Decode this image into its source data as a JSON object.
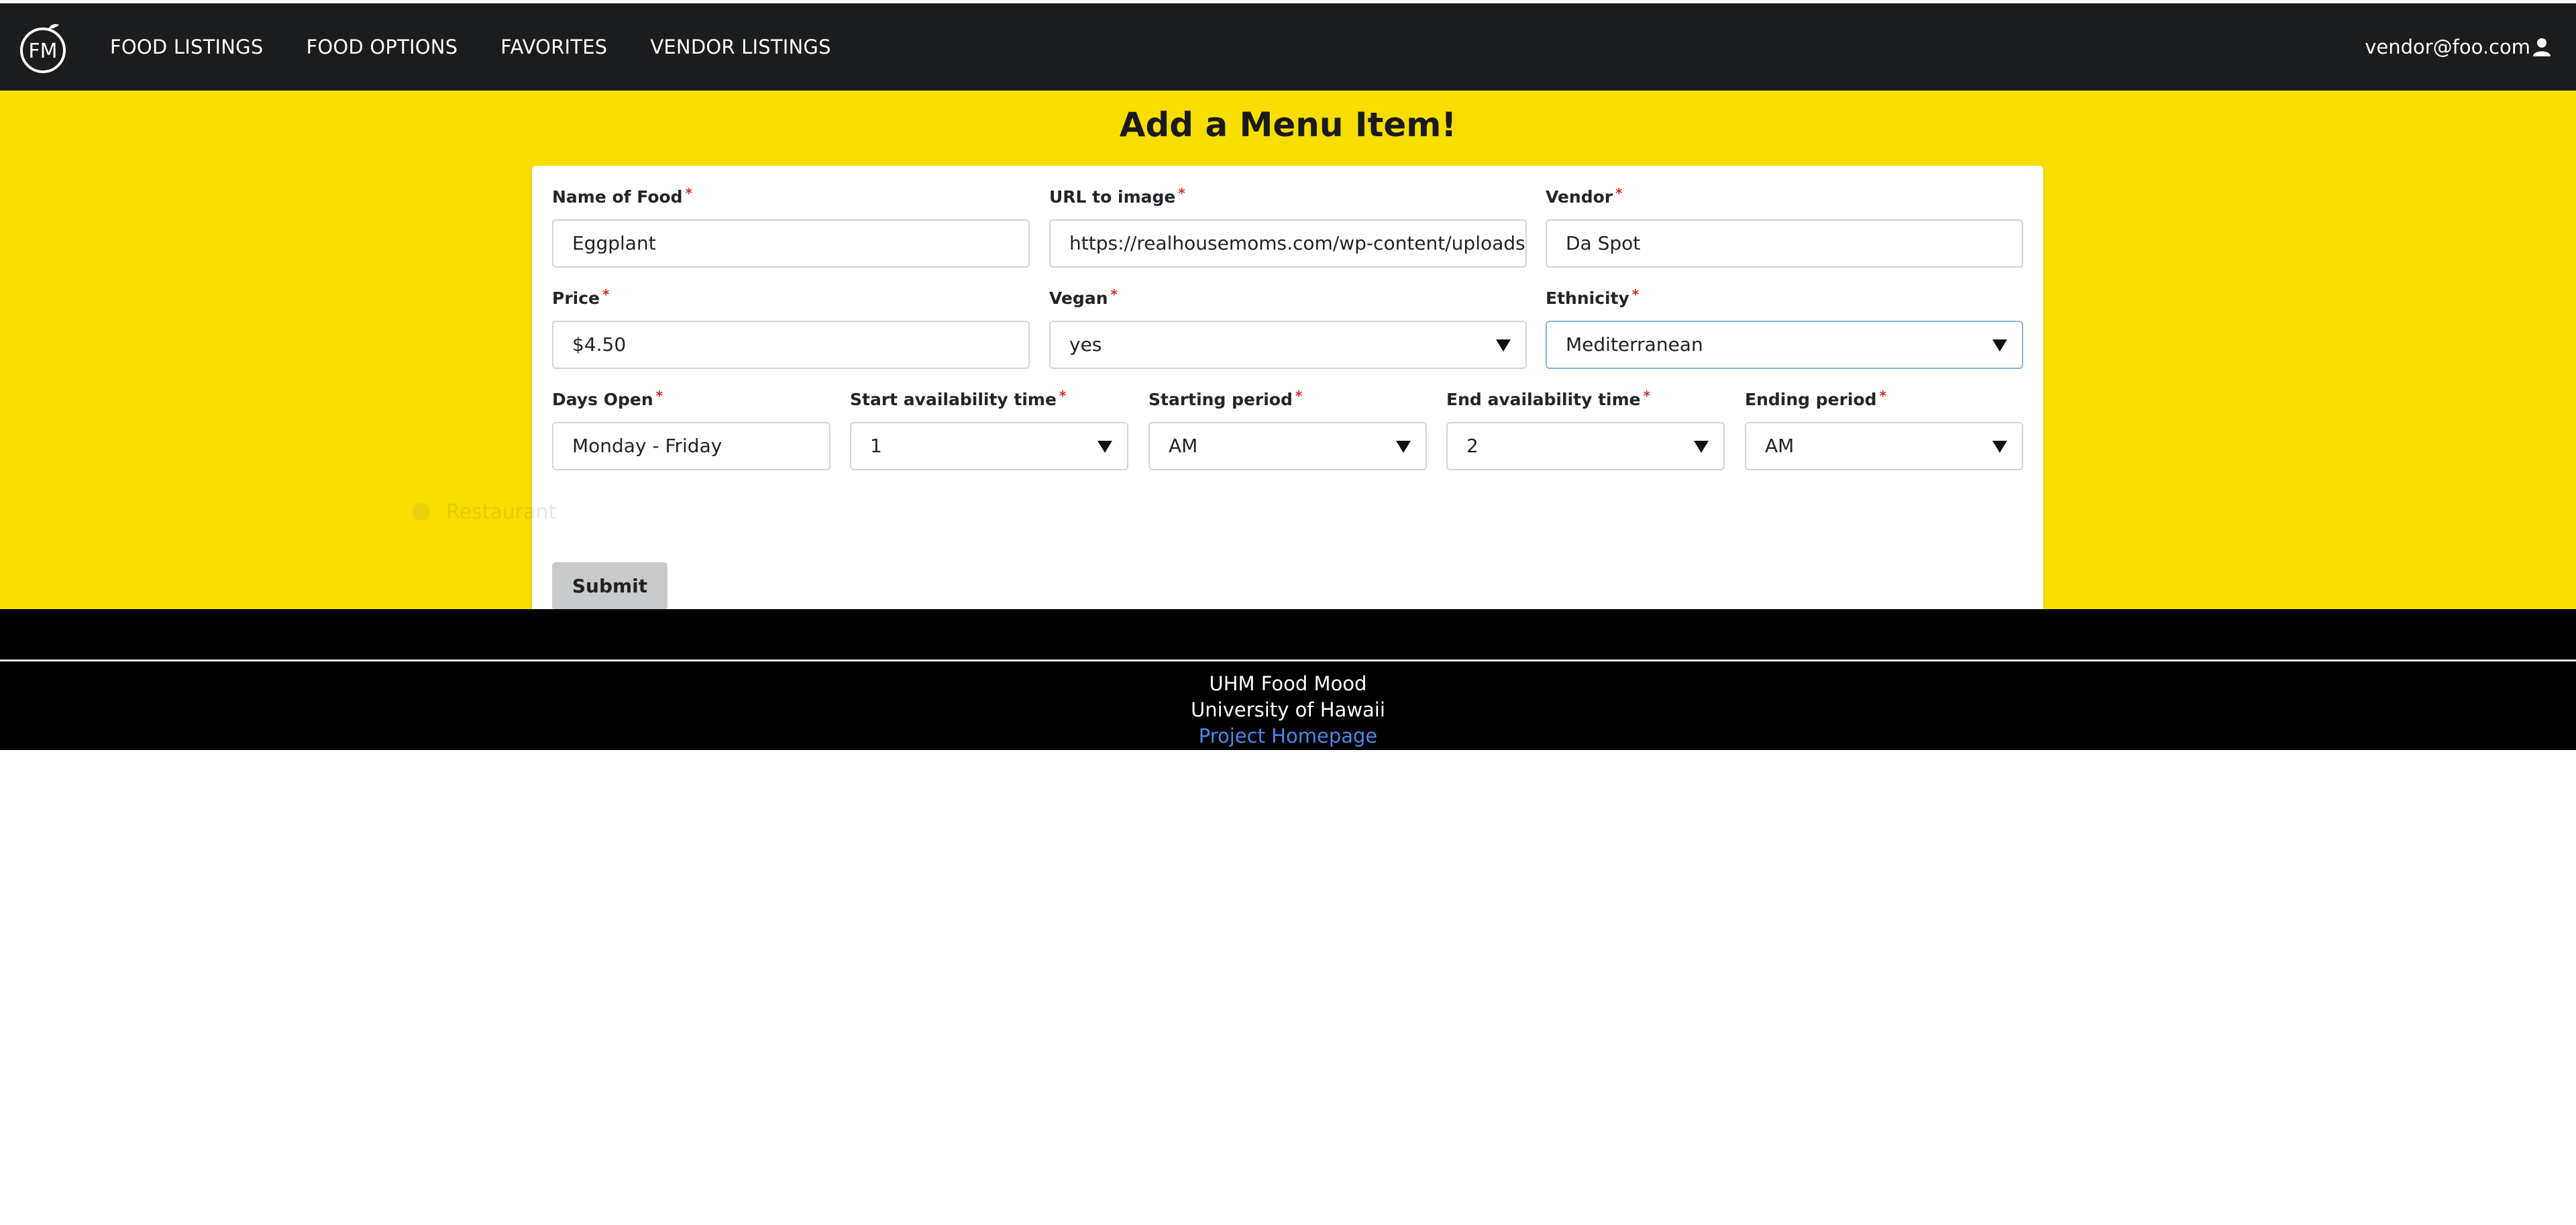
{
  "nav": {
    "logo_text": "FM",
    "links": [
      "FOOD LISTINGS",
      "FOOD OPTIONS",
      "FAVORITES",
      "VENDOR LISTINGS"
    ],
    "user": "vendor@foo.com",
    "user_icon": "user-icon"
  },
  "page": {
    "title": "Add a Menu Item!"
  },
  "form": {
    "name": {
      "label": "Name of Food",
      "value": "Eggplant"
    },
    "url": {
      "label": "URL to image",
      "value": "https://realhousemoms.com/wp-content/uploads/Egg"
    },
    "vendor": {
      "label": "Vendor",
      "value": "Da Spot"
    },
    "price": {
      "label": "Price",
      "value": "$4.50"
    },
    "vegan": {
      "label": "Vegan",
      "value": "yes"
    },
    "ethnicity": {
      "label": "Ethnicity",
      "value": "Mediterranean"
    },
    "days": {
      "label": "Days Open",
      "value": "Monday - Friday"
    },
    "start_time": {
      "label": "Start availability time",
      "value": "1"
    },
    "start_period": {
      "label": "Starting period",
      "value": "AM"
    },
    "end_time": {
      "label": "End availability time",
      "value": "2"
    },
    "end_period": {
      "label": "Ending period",
      "value": "AM"
    },
    "required_mark": "*",
    "submit_label": "Submit",
    "ghost_label": "Restaurant"
  },
  "footer": {
    "line1": "UHM Food Mood",
    "line2": "University of Hawaii",
    "link": "Project Homepage"
  },
  "colors": {
    "brand_yellow": "#f7dd00",
    "navbar": "#1b1c1d",
    "footer": "#000000",
    "link": "#4a88e8",
    "required": "#db2828"
  }
}
